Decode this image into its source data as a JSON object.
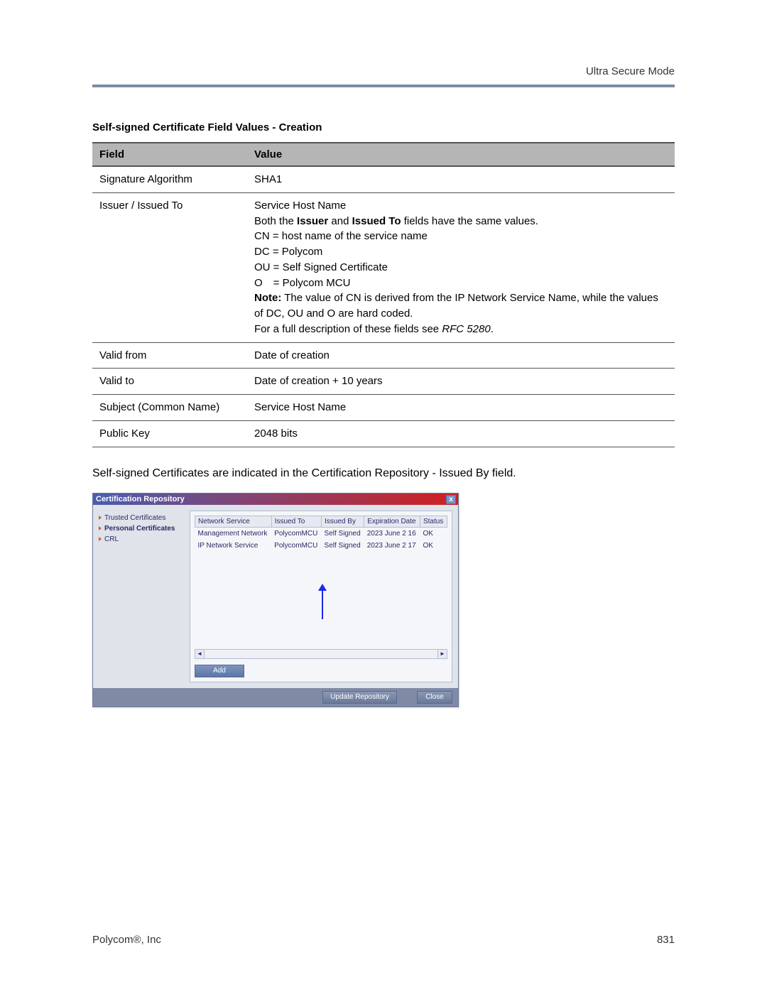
{
  "header": {
    "title": "Ultra Secure Mode"
  },
  "tableTitle": "Self-signed Certificate Field Values - Creation",
  "columns": {
    "field": "Field",
    "value": "Value"
  },
  "rows": {
    "r0": {
      "field": "Signature Algorithm",
      "value": "SHA1"
    },
    "r1": {
      "field": "Issuer / Issued To",
      "line1": "Service Host Name",
      "line2a": "Both the ",
      "line2b": "Issuer",
      "line2c": " and ",
      "line2d": "Issued To",
      "line2e": " fields have the same values.",
      "line3": "CN = host name of the service name",
      "line4": "DC = Polycom",
      "line5": "OU = Self Signed Certificate",
      "line6": "O = Polycom MCU",
      "line7a": "Note:",
      "line7b": " The value of CN is derived from the IP Network Service Name, while the values of DC, OU and O are hard coded.",
      "line8a": "For a full description of these fields see ",
      "line8b": "RFC 5280",
      "line8c": "."
    },
    "r2": {
      "field": "Valid from",
      "value": "Date of creation"
    },
    "r3": {
      "field": "Valid to",
      "value": "Date of creation + 10 years"
    },
    "r4": {
      "field": "Subject (Common Name)",
      "value": "Service Host Name"
    },
    "r5": {
      "field": "Public Key",
      "value": "2048 bits"
    }
  },
  "paragraph": "Self-signed Certificates are indicated in the Certification Repository - Issued By field.",
  "dialog": {
    "title": "Certification Repository",
    "close": "x",
    "tree": {
      "trusted": "Trusted Certificates",
      "personal": "Personal Certificates",
      "crl": "CRL"
    },
    "gridHeaders": {
      "svc": "Network Service",
      "to": "Issued To",
      "by": "Issued By",
      "exp": "Expiration Date",
      "status": "Status"
    },
    "gridRows": {
      "row0": {
        "svc": "Management Network",
        "to": "PolycomMCU",
        "by": "Self Signed",
        "exp": "2023 June 2 16",
        "status": "OK"
      },
      "row1": {
        "svc": "IP Network Service",
        "to": "PolycomMCU",
        "by": "Self Signed",
        "exp": "2023 June 2 17",
        "status": "OK"
      }
    },
    "addBtn": "Add",
    "updateBtn": "Update Repository",
    "closeBtn": "Close"
  },
  "footer": {
    "left": "Polycom®, Inc",
    "right": "831"
  }
}
